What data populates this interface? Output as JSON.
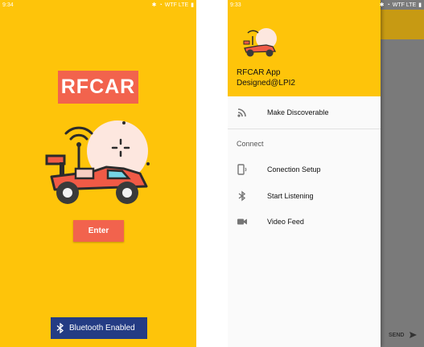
{
  "colors": {
    "background_yellow": "#fec40a",
    "accent_red": "#f2634d",
    "bluetooth_blue": "#243c84",
    "scrim_grey": "#7a7a7a"
  },
  "left_screen": {
    "status": {
      "time": "9:34",
      "carrier": "WTF LTE"
    },
    "title": "RFCAR",
    "enter_label": "Enter",
    "bluetooth_label": "Bluetooth Enabled"
  },
  "right_screen": {
    "status": {
      "time": "9:33",
      "carrier": "WTF LTE"
    },
    "drawer": {
      "app_name": "RFCAR App",
      "designer": "Designed@LPI2",
      "items": [
        {
          "label": "Make Discoverable",
          "icon": "cast-icon"
        }
      ],
      "section_title": "Connect",
      "section_items": [
        {
          "label": "Conection Setup",
          "icon": "phone-signal-icon"
        },
        {
          "label": "Start Listening",
          "icon": "bluetooth-icon"
        },
        {
          "label": "Video Feed",
          "icon": "video-camera-icon"
        }
      ]
    },
    "send_label": "SEND"
  }
}
